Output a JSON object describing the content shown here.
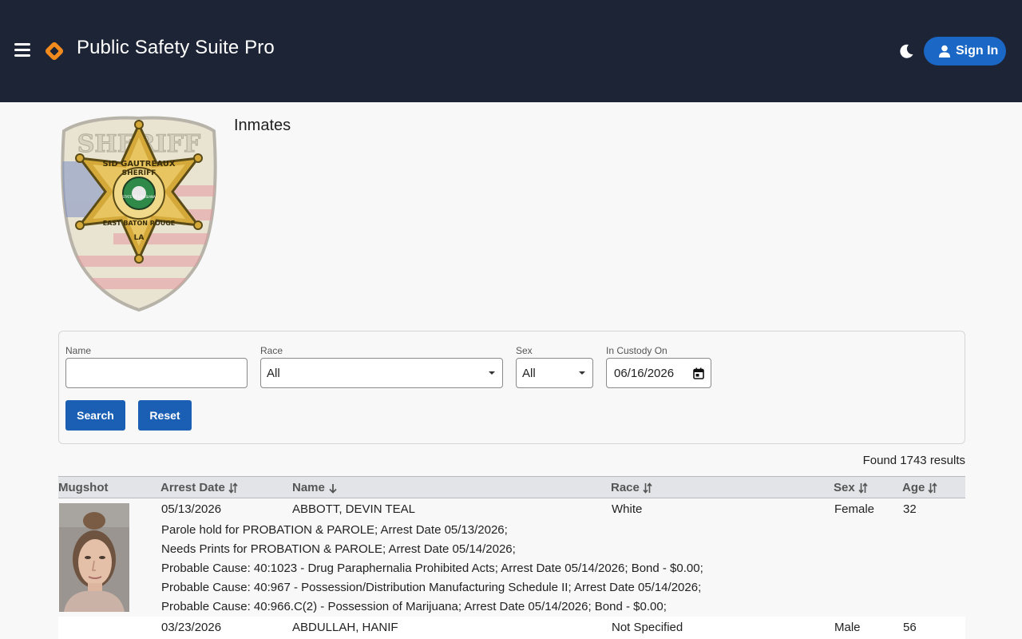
{
  "header": {
    "app_title": "Public Safety Suite Pro",
    "signin_label": "Sign In",
    "colors": {
      "background": "#1c2436",
      "accent": "#1a67c6"
    }
  },
  "page": {
    "heading": "Inmates",
    "seal_text_top": "SHERIFF",
    "seal_text_name": "SID GAUTREAUX",
    "seal_text_sheriff": "SHERIFF",
    "seal_text_region": "EAST BATON ROUGE",
    "seal_text_state": "LA",
    "seal_center_text": "STATE OF LOUISIANA"
  },
  "filters": {
    "name_label": "Name",
    "name_value": "",
    "race_label": "Race",
    "race_value": "All",
    "sex_label": "Sex",
    "sex_value": "All",
    "custody_label": "In Custody On",
    "custody_value": "06/16/2026",
    "search_label": "Search",
    "reset_label": "Reset"
  },
  "results": {
    "found_text": "Found 1743 results"
  },
  "table": {
    "columns": [
      "Mugshot",
      "Arrest Date",
      "Name",
      "Race",
      "Sex",
      "Age"
    ],
    "rows": [
      {
        "arrest_date": "05/13/2026",
        "name": "ABBOTT, DEVIN TEAL",
        "race": "White",
        "sex": "Female",
        "age": "32",
        "charges": [
          "Parole hold for PROBATION & PAROLE; Arrest Date 05/13/2026;",
          "Needs Prints for PROBATION & PAROLE; Arrest Date 05/14/2026;",
          "Probable Cause: 40:1023 - Drug Paraphernalia Prohibited Acts; Arrest Date 05/14/2026; Bond - $0.00;",
          "Probable Cause: 40:967 - Possession/Distribution Manufacturing Schedule II; Arrest Date 05/14/2026;",
          "Probable Cause: 40:966.C(2) - Possession of Marijuana; Arrest Date 05/14/2026; Bond - $0.00;"
        ]
      },
      {
        "arrest_date": "03/23/2026",
        "name": "ABDULLAH, HANIF",
        "race": "Not Specified",
        "sex": "Male",
        "age": "56",
        "charges": []
      }
    ]
  },
  "icons": {
    "menu": "hamburger-menu-icon",
    "brand": "diamond-logo-icon",
    "theme": "moon-icon",
    "user": "user-icon",
    "sort": "sort-arrows-icon",
    "sort_active": "arrow-down-icon",
    "calendar": "calendar-icon"
  }
}
